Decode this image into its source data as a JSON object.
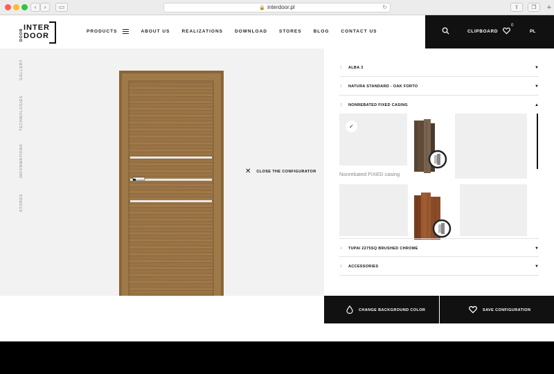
{
  "browser": {
    "url": "interdoor.pl"
  },
  "header": {
    "logo_line1": "INTER",
    "logo_line2": "DOOR",
    "nav": [
      "PRODUCTS",
      "ABOUT US",
      "REALIZATIONS",
      "DOWNLOAD",
      "STORES",
      "BLOG",
      "CONTACT US"
    ],
    "clipboard_label": "CLIPBOARD",
    "clipboard_count": "0",
    "language": "PL"
  },
  "side_nav": [
    "DOOR",
    "GALLERY",
    "TECHNOLOGIES",
    "INFORMATIONS",
    "STORES"
  ],
  "configurator": {
    "close_label": "CLOSE THE CONFIGURATOR",
    "steps": [
      {
        "num": "1",
        "title": "ALBA 3",
        "expanded": false
      },
      {
        "num": "2",
        "title": "NATURA STANDARD - OAK FORTO",
        "expanded": false
      },
      {
        "num": "3",
        "title": "NONREBATED FIXED CASING",
        "expanded": true
      },
      {
        "num": "4",
        "title": "TUPAI 2275SQ BRUSHED CHROME",
        "expanded": false
      },
      {
        "num": "5",
        "title": "ACCESSORIES",
        "expanded": false
      }
    ],
    "selected_option_caption": "Nonrebated FIXED casing",
    "change_bg_label": "CHANGE BACKGROUND COLOR",
    "save_label": "SAVE CONFIGURATION"
  },
  "colors": {
    "dark": "#111111",
    "panel_bg": "#f2f2f2",
    "door_wood": "#9a7445"
  }
}
